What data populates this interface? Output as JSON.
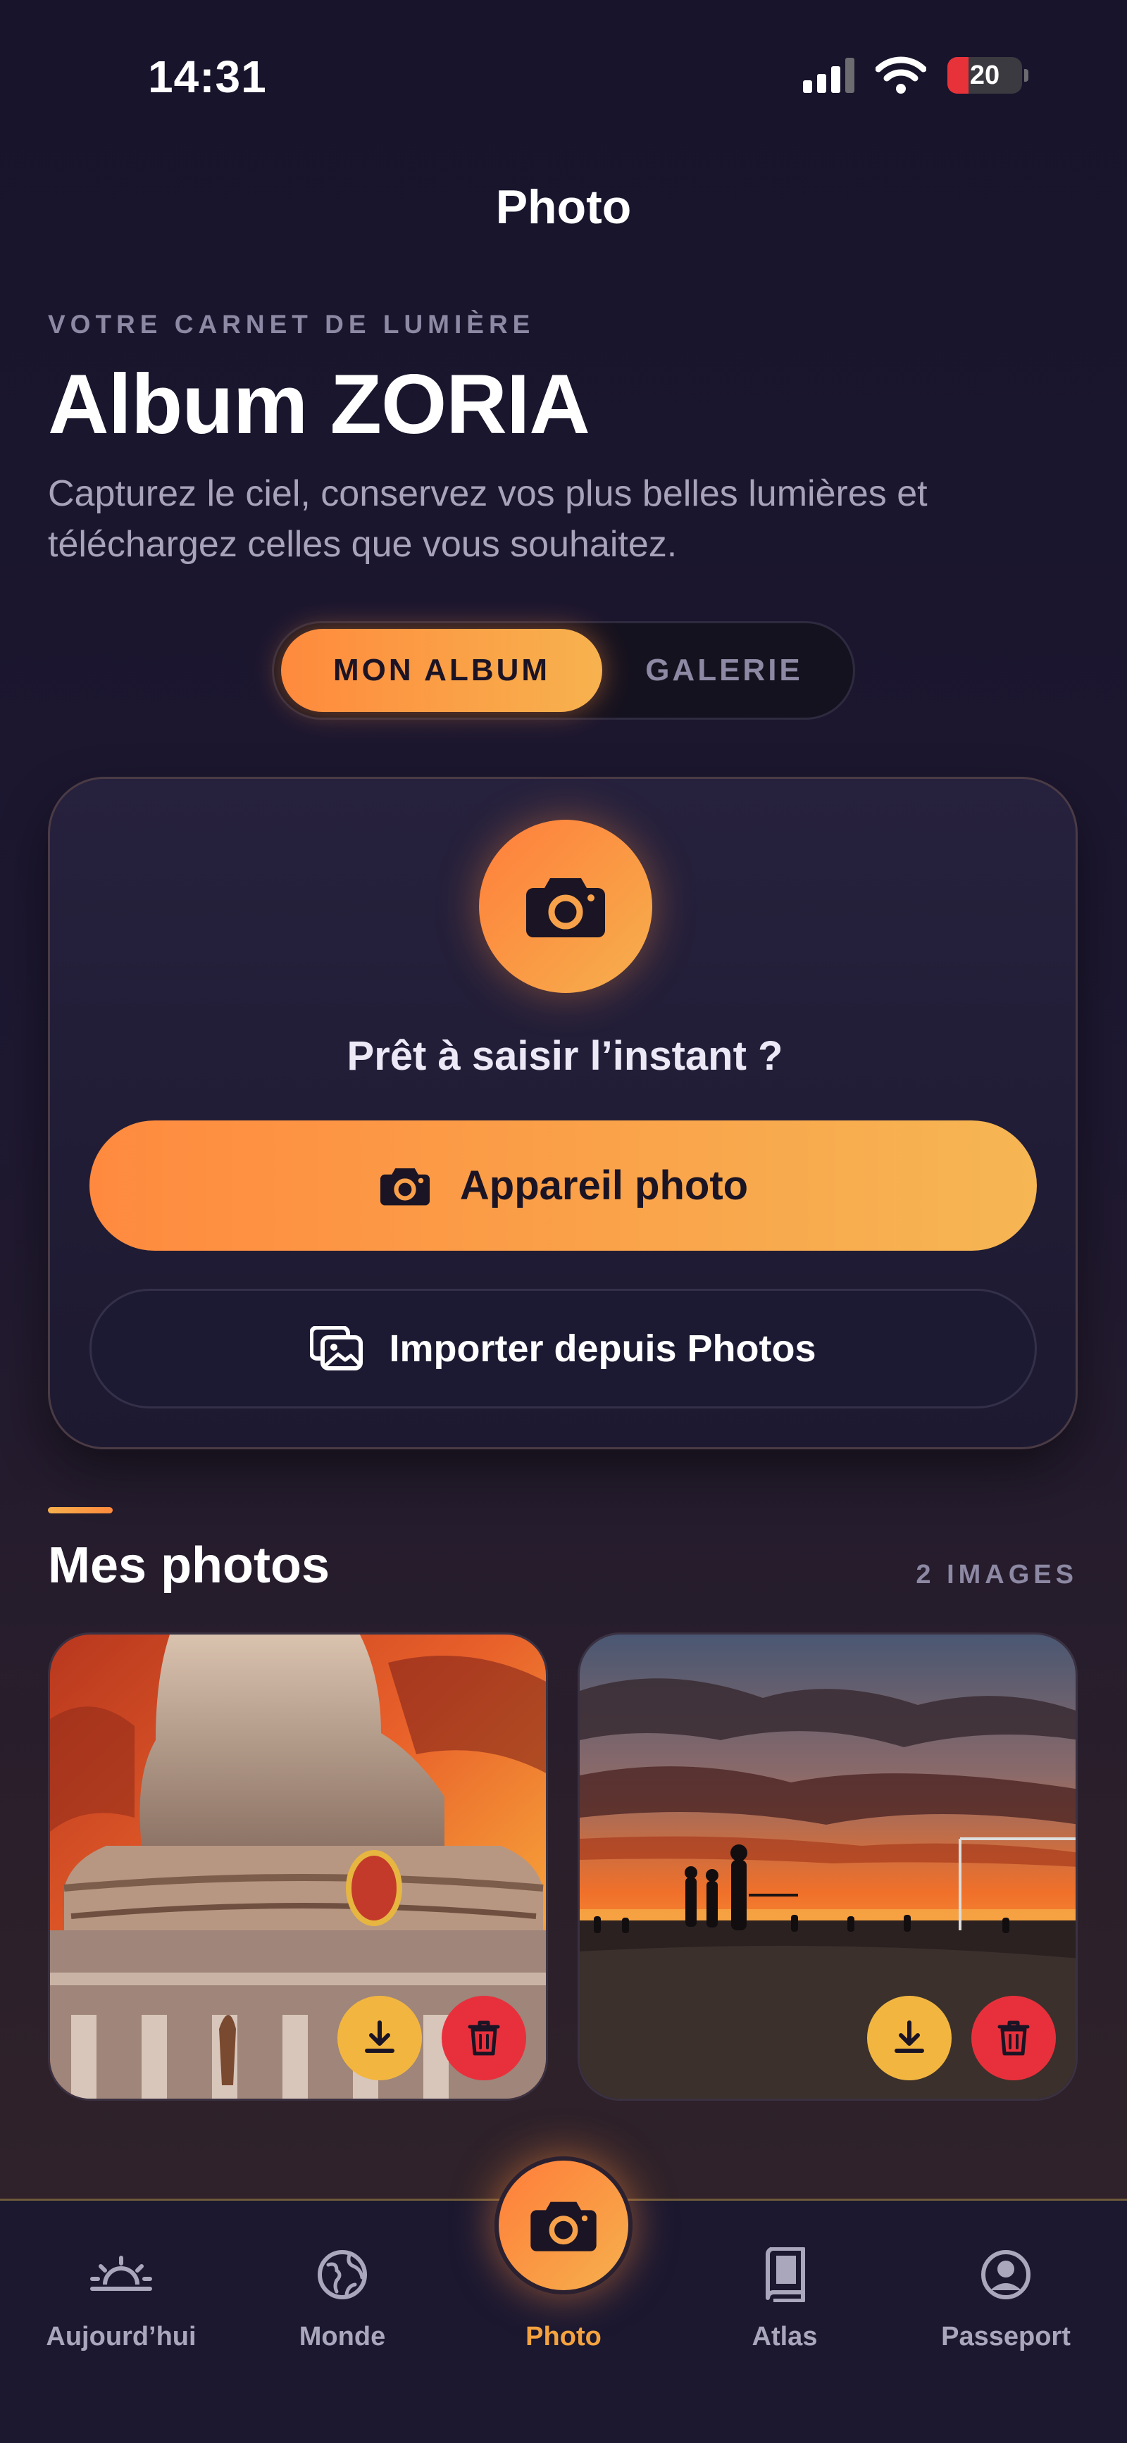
{
  "status_bar": {
    "time": "14:31",
    "battery": "20"
  },
  "header": {
    "title": "Photo"
  },
  "intro": {
    "eyebrow": "VOTRE CARNET DE LUMIÈRE",
    "title": "Album ZORIA",
    "subtitle": "Capturez le ciel, conservez vos plus belles lumières et téléchargez celles que vous souhaitez."
  },
  "segmented": {
    "active": "MON ALBUM",
    "inactive": "GALERIE"
  },
  "capture": {
    "prompt": "Prêt à saisir l’instant ?",
    "camera_button": "Appareil photo",
    "import_button": "Importer depuis Photos"
  },
  "photos_section": {
    "title": "Mes photos",
    "count": "2 IMAGES"
  },
  "tabbar": {
    "today": "Aujourd’hui",
    "world": "Monde",
    "photo": "Photo",
    "atlas": "Atlas",
    "passport": "Passeport"
  },
  "colors": {
    "accent_orange": "#ff8a3d",
    "accent_yellow": "#f6b04d",
    "delete_red": "#e8303c",
    "background": "#17142b"
  }
}
